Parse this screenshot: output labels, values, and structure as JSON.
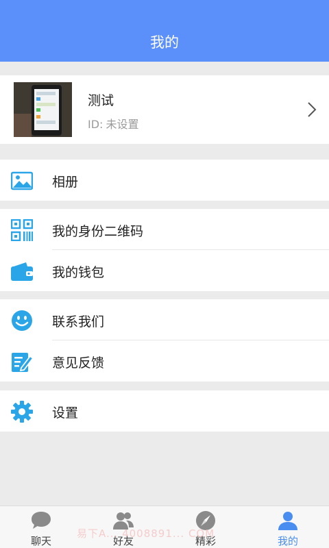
{
  "header": {
    "title": "我的"
  },
  "profile": {
    "name": "测试",
    "id_label": "ID:",
    "id_value": "未设置"
  },
  "menu": {
    "album": {
      "label": "相册",
      "icon": "image-icon"
    },
    "qrcode": {
      "label": "我的身份二维码",
      "icon": "qrcode-icon"
    },
    "wallet": {
      "label": "我的钱包",
      "icon": "wallet-icon"
    },
    "contact": {
      "label": "联系我们",
      "icon": "smiley-icon"
    },
    "feedback": {
      "label": "意见反馈",
      "icon": "edit-note-icon"
    },
    "settings": {
      "label": "设置",
      "icon": "gear-icon"
    }
  },
  "tabs": [
    {
      "label": "聊天",
      "icon": "chat-bubble-icon",
      "active": false
    },
    {
      "label": "好友",
      "icon": "contacts-icon",
      "active": false
    },
    {
      "label": "精彩",
      "icon": "compass-icon",
      "active": false
    },
    {
      "label": "我的",
      "icon": "person-icon",
      "active": true
    }
  ],
  "watermark": "易下A... 4008891... COM",
  "colors": {
    "header": "#5b8ff9",
    "icon": "#2aa6e8",
    "active_tab": "#4a8df0",
    "inactive_tab": "#8a8a8a"
  }
}
